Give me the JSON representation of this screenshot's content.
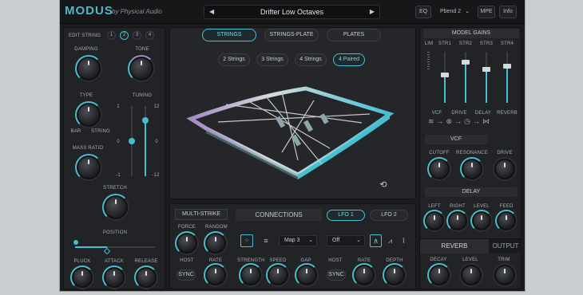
{
  "app": {
    "title": "MODUS",
    "subtitle": "by Physical Audio"
  },
  "preset": {
    "name": "Drifter Low Octaves",
    "prev_icon": "left-triangle-icon",
    "next_icon": "right-triangle-icon"
  },
  "topbar": {
    "eq": "EQ",
    "instance": "Pbend 2",
    "mpe": "MPE",
    "info": "Info"
  },
  "left": {
    "edit_string_label": "EDIT STRING",
    "strings": [
      "1",
      "2",
      "3",
      "4"
    ],
    "selected_string": "2",
    "damping": "DAMPING",
    "tone": "TONE",
    "type": "TYPE",
    "type_min": "BAR",
    "type_max": "STRING",
    "tuning": "TUNING",
    "tuning_scale_left": [
      "1",
      "0",
      "-1"
    ],
    "tuning_scale_right": [
      "12",
      "0",
      "-12"
    ],
    "mass_ratio": "MASS RATIO",
    "stretch": "STRETCH",
    "position": "POSITION",
    "pluck": "PLUCK",
    "attack": "ATTACK",
    "release": "RELEASE"
  },
  "model": {
    "tabs": [
      "STRINGS",
      "STRINGS-PLATE",
      "PLATES"
    ],
    "active_tab": "STRINGS",
    "variants": [
      "2 Strings",
      "3 Strings",
      "4 Strings",
      "4 Paired"
    ],
    "active_variant": "4 Paired"
  },
  "bottom": {
    "multi_strike": "MULTI-STRIKE",
    "force": "FORCE",
    "random": "RANDOM",
    "host": "HOST",
    "rate": "RATE",
    "sync": "SYNC",
    "connections": "CONNECTIONS",
    "map": "Map 3",
    "lfo_mode": "Off",
    "lfo1": "LFO 1",
    "lfo2": "LFO 2",
    "strength": "STRENGTH",
    "speed": "SPEED",
    "gap": "GAP",
    "host2": "HOST",
    "rate2": "RATE",
    "depth": "DEPTH",
    "sync2": "SYNC"
  },
  "right": {
    "model_gains": "MODEL GAINS",
    "gain_labels": [
      "LIM",
      "STR1",
      "STR2",
      "STR3",
      "STR4"
    ],
    "gain_levels": [
      0.55,
      0.8,
      0.65,
      0.72
    ],
    "chain": [
      "VCF",
      "DRIVE",
      "DELAY",
      "REVERB"
    ],
    "vcf": "VCF",
    "cutoff": "CUTOFF",
    "resonance": "RESONANCE",
    "drive": "DRIVE",
    "delay": "DELAY",
    "left": "LEFT",
    "right": "RIGHT",
    "level": "LEVEL",
    "feed": "FEED",
    "reverb": "REVERB",
    "output": "OUTPUT",
    "decay": "DECAY",
    "level2": "LEVEL",
    "trim": "TRIM"
  },
  "colors": {
    "accent": "#45c0d0",
    "background": "#1b1c1f",
    "panel": "#222326",
    "frame_side": "#a58ac7"
  }
}
